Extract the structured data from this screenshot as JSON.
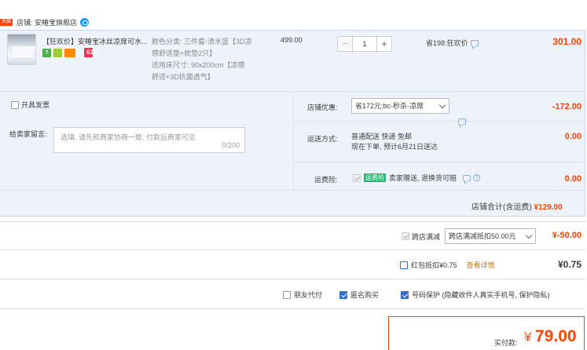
{
  "shop": {
    "tag": "天猫",
    "label": "店铺: 安睡宝旗舰店"
  },
  "item": {
    "title": "【狂欢价】安睡宝冰丝凉席可水...",
    "badge_618": "618",
    "sku_lines": [
      "颜色分类: 三件套-清水蓝【3D凉",
      "感舒适垫+枕垫2只】",
      "适用床尺寸: 90x200cm【凉感",
      "舒适+3D抗菌透气】"
    ],
    "unit_price": "499.00",
    "quantity": "1",
    "minus": "−",
    "plus": "+",
    "promo": "省198:狂欢价",
    "subtotal": "301.00"
  },
  "invoice": {
    "label": "开具发票"
  },
  "message": {
    "label": "给卖家留言:",
    "placeholder": "选填, 请先和商家协商一致, 付款后商家可见",
    "count": "0/200"
  },
  "shop_discount": {
    "label": "店铺优惠:",
    "selected": "省172元:bc-秒杀-凉席",
    "amount": "-172.00"
  },
  "shipping": {
    "label": "运送方式:",
    "method": "普通配送 快递 免邮",
    "eta": "现在下单, 预计6月21日送达",
    "amount": "0.00"
  },
  "insurance": {
    "label": "运费险:",
    "tag": "运费险",
    "text": "卖家赠送, 退换货可赔",
    "help": "?",
    "amount": "0.00"
  },
  "shop_total": {
    "label": "店铺合计(含运费)",
    "amount": "¥129.00"
  },
  "cross_store": {
    "label": "跨店满减",
    "selected": "跨店满减抵扣50.00元",
    "amount": "¥-50.00"
  },
  "red_packet": {
    "label": "红包抵扣¥0.75",
    "link": "查看详情",
    "amount": "¥0.75"
  },
  "options": {
    "pay_for_friend": "朋友代付",
    "anonymous": "匿名购买",
    "privacy": "号码保护 (隐藏收件人真实手机号, 保护隐私)"
  },
  "payment": {
    "label": "实付款:",
    "yen": "¥",
    "amount": "79.00"
  },
  "colors": {
    "accent": "#ff4400",
    "panel_bg": "#eef3fb",
    "check_blue": "#2f6fd1"
  }
}
